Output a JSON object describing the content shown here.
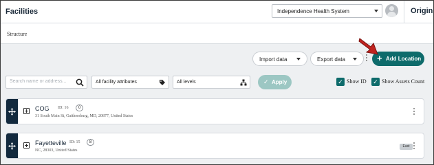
{
  "header": {
    "title": "Facilities",
    "org_selector": {
      "value": "Independence Health System"
    },
    "origin_label": "Origin"
  },
  "subheader": {
    "breadcrumb": "Structure"
  },
  "toolbar": {
    "import_label": "Import data",
    "export_label": "Export data",
    "add_location_label": "Add Location",
    "accent_color": "#0e6b6b"
  },
  "filters": {
    "search_placeholder": "Search name or address...",
    "search_value": "",
    "attributes_value": "All facility attributes",
    "levels_value": "All levels",
    "apply_label": "Apply",
    "show_id_label": "Show ID",
    "show_id_checked": true,
    "show_assets_label": "Show Assets Count",
    "show_assets_checked": true
  },
  "locations": [
    {
      "name": "COG",
      "id": "ID: 16",
      "count": "0",
      "address": "31 South Main St, Gaithersburg, MD, 20877, United States",
      "badge": ""
    },
    {
      "name": "Fayetteville",
      "id": "ID: 15",
      "count": "8",
      "address": "NC, 28303, United States",
      "badge": "East"
    }
  ]
}
